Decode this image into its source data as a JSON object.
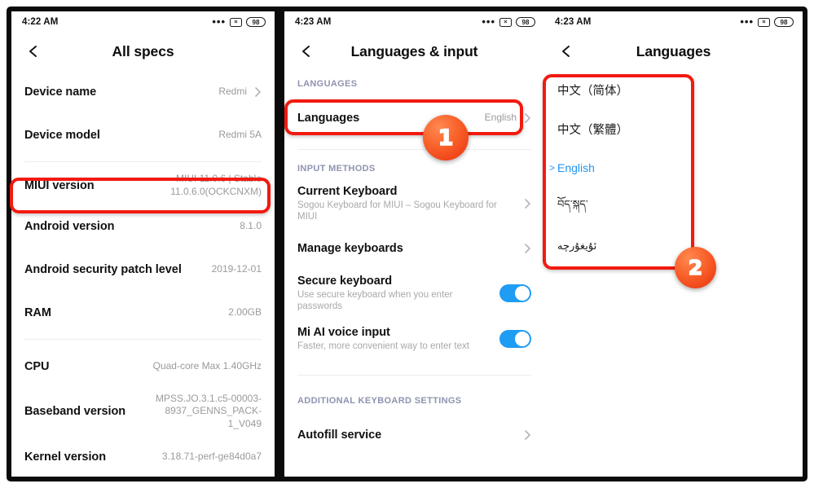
{
  "theme": {
    "accent_blue": "#1f9cf4",
    "link_blue": "#2196f3",
    "annotation_red": "#f21a10",
    "badge_orange": "#f9602a",
    "section_label_color": "#8f93b0"
  },
  "panels": [
    {
      "id": "all-specs",
      "statusbar": {
        "time": "4:22 AM",
        "dots_icon": "overflow-dots-icon",
        "sim_icon": "no-sim-icon",
        "sim_glyph": "×",
        "battery_icon": "battery-icon",
        "battery_level": "98"
      },
      "appbar": {
        "back_icon": "back-chevron-icon",
        "title": "All specs"
      },
      "rows": [
        {
          "title": "Device name",
          "value": "Redmi",
          "chevron": true
        },
        {
          "title": "Device model",
          "value": "Redmi 5A",
          "chevron": false
        },
        {
          "divider": true
        },
        {
          "title": "MIUI version",
          "value": "MIUI 11.0.6 | Stable\n11.0.6.0(OCKCNXM)",
          "chevron": false,
          "highlighted": true
        },
        {
          "title": "Android version",
          "value": "8.1.0",
          "chevron": false
        },
        {
          "title": "Android security patch level",
          "value": "2019-12-01",
          "chevron": false
        },
        {
          "title": "RAM",
          "value": "2.00GB",
          "chevron": false
        },
        {
          "divider": true
        },
        {
          "title": "CPU",
          "value": "Quad-core Max 1.40GHz",
          "chevron": false
        },
        {
          "title": "Baseband version",
          "value": "MPSS.JO.3.1.c5-00003-\n8937_GENNS_PACK-\n1_V049",
          "chevron": false
        },
        {
          "title": "Kernel version",
          "value": "3.18.71-perf-ge84d0a7",
          "chevron": false
        }
      ]
    },
    {
      "id": "languages-and-input",
      "statusbar": {
        "time": "4:23 AM",
        "dots_icon": "overflow-dots-icon",
        "sim_icon": "no-sim-icon",
        "sim_glyph": "×",
        "battery_icon": "battery-icon",
        "battery_level": "98"
      },
      "appbar": {
        "back_icon": "back-chevron-icon",
        "title": "Languages & input"
      },
      "sections": [
        {
          "label": "LANGUAGES",
          "rows": [
            {
              "title": "Languages",
              "value": "English",
              "chevron": true,
              "highlighted": true
            }
          ]
        },
        {
          "label": "INPUT METHODS",
          "rows": [
            {
              "title": "Current Keyboard",
              "sub": "Sogou Keyboard for MIUI – Sogou Keyboard for MIUI",
              "chevron": true
            },
            {
              "title": "Manage keyboards",
              "chevron": true
            },
            {
              "title": "Secure keyboard",
              "sub": "Use secure keyboard when you enter passwords",
              "toggle": true,
              "toggle_on": true
            },
            {
              "title": "Mi AI voice input",
              "sub": "Faster, more convenient way to enter text",
              "toggle": true,
              "toggle_on": true
            }
          ]
        },
        {
          "label": "ADDITIONAL KEYBOARD SETTINGS",
          "rows": [
            {
              "title": "Autofill service",
              "chevron": true
            }
          ]
        }
      ]
    },
    {
      "id": "languages",
      "statusbar": {
        "time": "4:23 AM",
        "dots_icon": "overflow-dots-icon",
        "sim_icon": "no-sim-icon",
        "sim_glyph": "×",
        "battery_icon": "battery-icon",
        "battery_level": "98"
      },
      "appbar": {
        "back_icon": "back-chevron-icon",
        "title": "Languages"
      },
      "languages": [
        {
          "label": "中文（简体）",
          "selected": false,
          "style": "cjk"
        },
        {
          "label": "中文（繁體）",
          "selected": false,
          "style": "cjk"
        },
        {
          "label": "English",
          "selected": true,
          "style": "latin"
        },
        {
          "label": "བོད་སྐད་",
          "selected": false,
          "style": "small"
        },
        {
          "label": "ئۇيغۇرچە",
          "selected": false,
          "style": "small"
        }
      ]
    }
  ],
  "annotations": [
    {
      "id": "step-1",
      "number": "1",
      "target": "languages-row"
    },
    {
      "id": "step-2",
      "number": "2",
      "target": "language-list"
    }
  ]
}
